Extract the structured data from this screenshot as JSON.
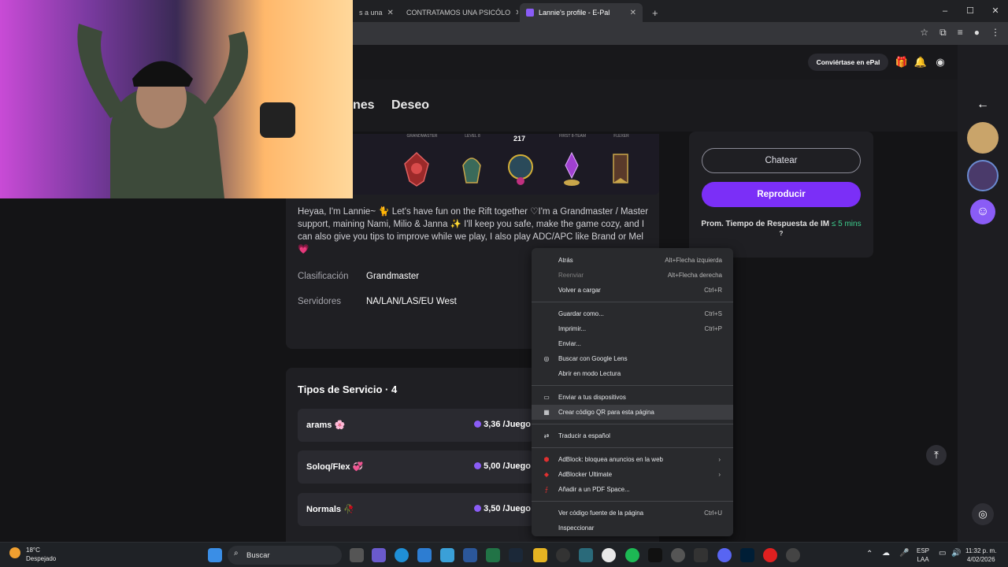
{
  "browser": {
    "tabs": [
      {
        "title": "s a una",
        "active": false
      },
      {
        "title": "CONTRATAMOS UNA PSICÓLO",
        "active": false
      },
      {
        "title": "Lannie's profile - E-Pal",
        "active": true
      }
    ],
    "new_tab_symbol": "+",
    "window_controls": [
      "–",
      "☐",
      "✕"
    ]
  },
  "site": {
    "become_epal": "Conviértase en ePal",
    "nav_tabs": [
      "nes",
      "Deseo"
    ],
    "ranks": {
      "labels": [
        "GRANDMASTER",
        "LEVEL 8",
        "",
        "FIRST 8-TEAM",
        "FLEXER"
      ],
      "score": "217"
    },
    "bio": "Heyaa, I'm Lannie~ 🐈 Let's have fun on the Rift together ♡I'm a Grandmaster / Master support, maining Nami, Milio & Janna ✨ I'll keep you safe, make the game cozy, and I can also give you tips to improve while we play, I also play ADC/APC like Brand or Mel 💗",
    "details": [
      {
        "label": "Clasificación",
        "value": "Grandmaster"
      },
      {
        "label": "Servidores",
        "value": "NA/LAN/LAS/EU West"
      }
    ],
    "side_card": {
      "chat": "Chatear",
      "play": "Reproducir",
      "response_label": "Prom. Tiempo de Respuesta de IM",
      "response_value": "≤ 5 mins",
      "response_help": "?"
    },
    "services_title": "Tipos de Servicio · 4",
    "services": [
      {
        "name": "arams 🌸",
        "price": "3,36 /Juego"
      },
      {
        "name": "Soloq/Flex 💞",
        "price": "5,00 /Juego"
      },
      {
        "name": "Normals 🥀",
        "price": "3,50 /Juego"
      }
    ]
  },
  "context_menu": {
    "items": [
      {
        "label": "Atrás",
        "shortcut": "Alt+Flecha izquierda"
      },
      {
        "label": "Reenviar",
        "shortcut": "Alt+Flecha derecha",
        "disabled": true
      },
      {
        "label": "Volver a cargar",
        "shortcut": "Ctrl+R"
      },
      {
        "label": "Guardar como...",
        "shortcut": "Ctrl+S"
      },
      {
        "label": "Imprimir...",
        "shortcut": "Ctrl+P"
      },
      {
        "label": "Enviar..."
      },
      {
        "label": "Buscar con Google Lens"
      },
      {
        "label": "Abrir en modo Lectura"
      },
      {
        "label": "Enviar a tus dispositivos"
      },
      {
        "label": "Crear código QR para esta página"
      },
      {
        "label": "Traducir a español"
      },
      {
        "label": "AdBlock: bloquea anuncios en la web"
      },
      {
        "label": "AdBlocker Ultimate"
      },
      {
        "label": "Añadir a un PDF Space..."
      },
      {
        "label": "Ver código fuente de la página",
        "shortcut": "Ctrl+U"
      },
      {
        "label": "Inspeccionar"
      }
    ]
  },
  "taskbar": {
    "weather_temp": "18°C",
    "weather_desc": "Despejado",
    "search_placeholder": "Buscar",
    "lang": "ESP",
    "lang2": "LAA",
    "time": "11:32 p. m.",
    "date": "4/02/2026"
  },
  "colors": {
    "accent": "#7b2ff7",
    "green": "#3ecf8e"
  }
}
